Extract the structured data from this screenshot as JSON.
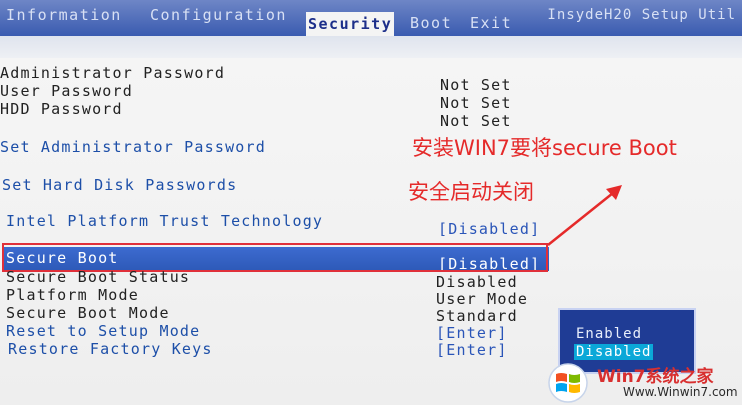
{
  "menu": {
    "tabs": [
      "Information",
      "Configuration",
      "Security",
      "Boot",
      "Exit"
    ],
    "active_tab": "Security",
    "brand": "InsydeH20 Setup Util"
  },
  "passwords": [
    {
      "label": "Administrator Password",
      "value": "Not Set"
    },
    {
      "label": "User Password",
      "value": "Not Set"
    },
    {
      "label": "HDD Password",
      "value": "Not Set"
    }
  ],
  "links": {
    "set_admin": "Set Administrator Password",
    "set_hdd": "Set Hard Disk Passwords"
  },
  "settings": {
    "ptt_label": "Intel Platform Trust Technology",
    "ptt_value": "[Disabled]",
    "secure_boot_label": "Secure Boot",
    "secure_boot_value": "[Disabled]",
    "secure_boot_status_label": "Secure Boot Status",
    "secure_boot_status_value": "Disabled",
    "platform_mode_label": "Platform Mode",
    "platform_mode_value": "User Mode",
    "secure_boot_mode_label": "Secure Boot Mode",
    "secure_boot_mode_value": "Standard",
    "reset_setup_label": "Reset to Setup Mode",
    "reset_setup_value": "[Enter]",
    "restore_keys_label": "Restore Factory Keys",
    "restore_keys_value": "[Enter]"
  },
  "popup": {
    "options": [
      "Enabled",
      "Disabled"
    ],
    "selected": "Disabled"
  },
  "annotation": {
    "line1": "安装WIN7要将secure Boot",
    "line2": "安全启动关闭",
    "color": "#e52a2a"
  },
  "watermark": {
    "title": "Win7系统之家",
    "url": "Www.Winwin7.com"
  },
  "colors": {
    "menu_bar": "#3a5bb0",
    "selection_bar": "#2d59b8",
    "popup_bg": "#1f3c95",
    "popup_selected": "#0ba8d8",
    "red_box": "#e0303a"
  }
}
